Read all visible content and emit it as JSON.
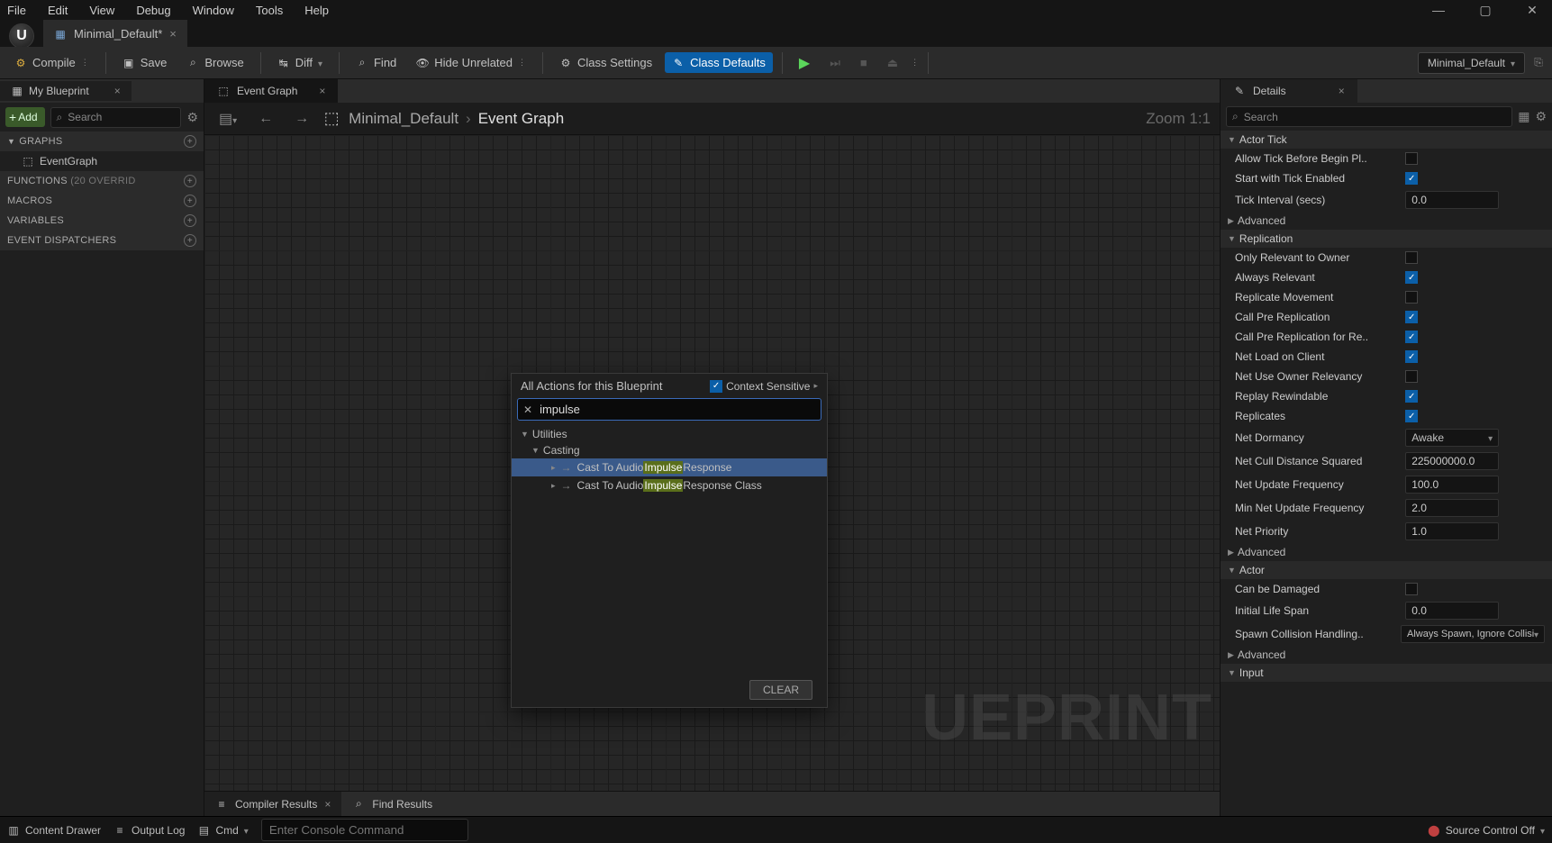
{
  "menu": [
    "File",
    "Edit",
    "View",
    "Debug",
    "Window",
    "Tools",
    "Help"
  ],
  "doc_tab": {
    "label": "Minimal_Default*"
  },
  "toolbar": {
    "compile": "Compile",
    "save": "Save",
    "browse": "Browse",
    "diff": "Diff",
    "find": "Find",
    "hide_unrelated": "Hide Unrelated",
    "class_settings": "Class Settings",
    "class_defaults": "Class Defaults",
    "context_dd": "Minimal_Default"
  },
  "left": {
    "tab": "My Blueprint",
    "add": "Add",
    "search_ph": "Search",
    "sections": {
      "graphs": "GRAPHS",
      "graph_item": "EventGraph",
      "functions": "FUNCTIONS",
      "functions_note": "(20 OVERRID",
      "macros": "MACROS",
      "variables": "VARIABLES",
      "dispatchers": "EVENT DISPATCHERS"
    }
  },
  "center": {
    "tab_event": "Event Graph",
    "breadcrumb_root": "Minimal_Default",
    "breadcrumb_leaf": "Event Graph",
    "zoom": "Zoom 1:1",
    "watermark": "UEPRINT",
    "bottom_compiler": "Compiler Results",
    "bottom_find": "Find Results"
  },
  "popup": {
    "title": "All Actions for this Blueprint",
    "ctx": "Context Sensitive",
    "search": "impulse",
    "group1": "Utilities",
    "group2": "Casting",
    "item1_pre": "Cast To Audio",
    "item1_hl": "Impulse",
    "item1_post": "Response",
    "item2_pre": "Cast To Audio",
    "item2_hl": "Impulse",
    "item2_post": "Response Class",
    "clear": "CLEAR"
  },
  "details": {
    "tab": "Details",
    "search_ph": "Search",
    "s_actor_tick": "Actor Tick",
    "allow_tick": "Allow Tick Before Begin Pl..",
    "start_tick": "Start with Tick Enabled",
    "tick_interval": "Tick Interval (secs)",
    "tick_interval_v": "0.0",
    "advanced": "Advanced",
    "s_rep": "Replication",
    "only_owner": "Only Relevant to Owner",
    "always_relevant": "Always Relevant",
    "rep_move": "Replicate Movement",
    "call_pre": "Call Pre Replication",
    "call_pre_re": "Call Pre Replication for Re..",
    "net_load": "Net Load on Client",
    "net_owner": "Net Use Owner Relevancy",
    "replay": "Replay Rewindable",
    "replicates": "Replicates",
    "net_dorm": "Net Dormancy",
    "net_dorm_v": "Awake",
    "net_cull": "Net Cull Distance Squared",
    "net_cull_v": "225000000.0",
    "net_upd": "Net Update Frequency",
    "net_upd_v": "100.0",
    "min_net_upd": "Min Net Update Frequency",
    "min_net_upd_v": "2.0",
    "net_pri": "Net Priority",
    "net_pri_v": "1.0",
    "s_actor": "Actor",
    "can_dmg": "Can be Damaged",
    "life": "Initial Life Span",
    "life_v": "0.0",
    "spawn": "Spawn Collision Handling..",
    "spawn_v": "Always Spawn, Ignore Collisions",
    "s_input": "Input"
  },
  "status": {
    "content": "Content Drawer",
    "output": "Output Log",
    "cmd": "Cmd",
    "cmd_ph": "Enter Console Command",
    "src": "Source Control Off"
  }
}
